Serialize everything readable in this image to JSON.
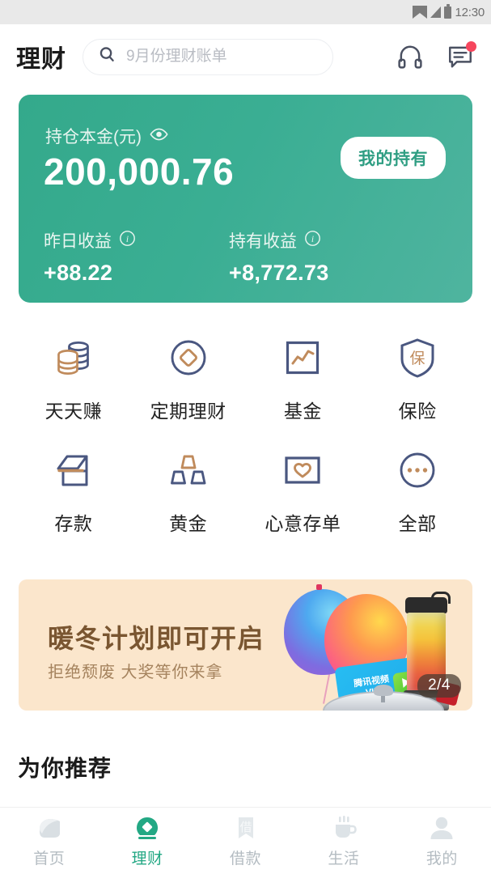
{
  "status_bar": {
    "time": "12:30",
    "icons": [
      "wifi-icon",
      "signal-icon",
      "battery-icon"
    ]
  },
  "header": {
    "brand": "理财",
    "search": {
      "placeholder": "9月份理财账单",
      "value": "",
      "icon": "search-icon"
    },
    "headset_icon": "headset-icon",
    "message_icon": "message-icon",
    "message_badge": true
  },
  "balance_card": {
    "principal_label": "持仓本金(元)",
    "eye_icon": "eye-icon",
    "amount": "200,000.76",
    "holdings_button": "我的持有",
    "accent": "#34a98b",
    "metrics": [
      {
        "label": "昨日收益",
        "info_icon": "info-icon",
        "value": "+88.22"
      },
      {
        "label": "持有收益",
        "info_icon": "info-icon",
        "value": "+8,772.73"
      }
    ]
  },
  "quick_grid": {
    "navy": "#4a5780",
    "tan": "#c08b5c",
    "items": [
      {
        "label": "天天赚",
        "icon": "coins-icon"
      },
      {
        "label": "定期理财",
        "icon": "circle-diamond-icon"
      },
      {
        "label": "基金",
        "icon": "chart-frame-icon"
      },
      {
        "label": "保险",
        "icon": "shield-bao-icon"
      },
      {
        "label": "存款",
        "icon": "open-box-icon"
      },
      {
        "label": "黄金",
        "icon": "gold-bars-icon"
      },
      {
        "label": "心意存单",
        "icon": "heart-frame-icon"
      },
      {
        "label": "全部",
        "icon": "more-dots-icon"
      }
    ]
  },
  "banner": {
    "title": "暖冬计划即可开启",
    "subtitle": "拒绝颓废  大奖等你来拿",
    "pager": "2/4",
    "background": "#fbe6cc",
    "vip_card": {
      "brand": "腾讯视频",
      "tier": "VIP",
      "play_icon": "play-icon"
    },
    "art": [
      "balloon-blue",
      "balloon-pink",
      "blender-bottle",
      "pot-lid"
    ]
  },
  "recommend": {
    "title": "为你推荐"
  },
  "tabbar": {
    "active_color": "#23a884",
    "inactive_color": "#b4bcc2",
    "tabs": [
      {
        "label": "首页",
        "icon": "home-icon",
        "active": false
      },
      {
        "label": "理财",
        "icon": "finance-icon",
        "active": true
      },
      {
        "label": "借款",
        "icon": "loan-icon",
        "active": false
      },
      {
        "label": "生活",
        "icon": "life-cup-icon",
        "active": false
      },
      {
        "label": "我的",
        "icon": "profile-icon",
        "active": false
      }
    ]
  }
}
